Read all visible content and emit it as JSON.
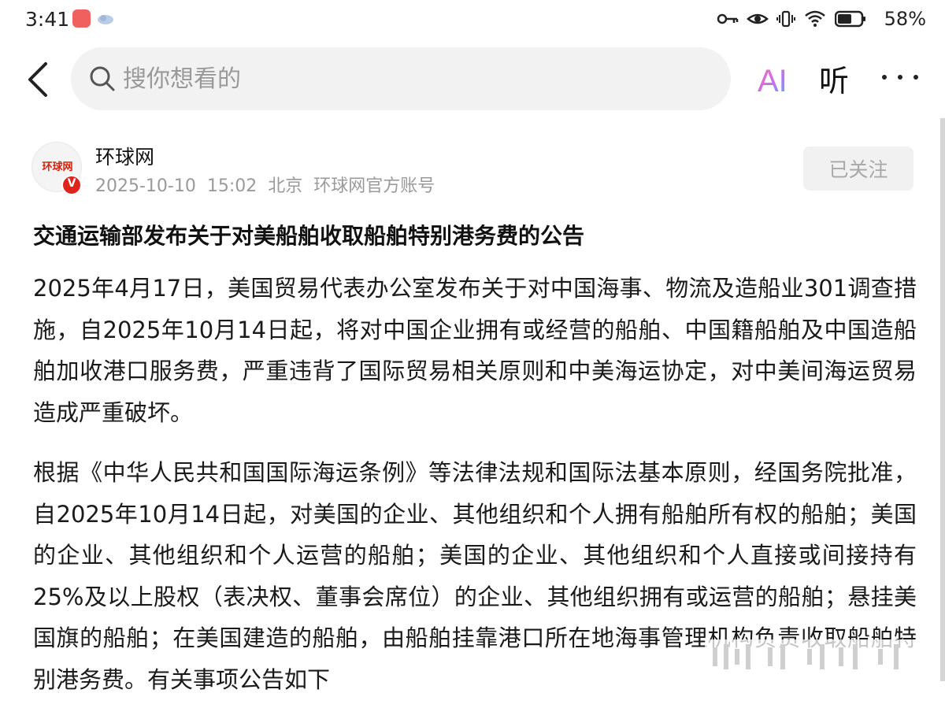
{
  "status_bar": {
    "time": "3:41",
    "battery_percent": "58%",
    "icons": [
      "key-icon",
      "eye-icon",
      "vibrate-icon",
      "wifi-icon",
      "battery-icon"
    ]
  },
  "top_bar": {
    "search_placeholder": "搜你想看的",
    "ai_label": "AI",
    "listen_label": "听"
  },
  "author": {
    "name": "环球网",
    "avatar_text": "环球网",
    "date": "2025-10-10",
    "time": "15:02",
    "location": "北京",
    "account_type": "环球网官方账号",
    "follow_label": "已关注",
    "verified_mark": "V"
  },
  "article": {
    "title": "交通运输部发布关于对美船舶收取船舶特别港务费的公告",
    "paragraphs": [
      "2025年4月17日，美国贸易代表办公室发布关于对中国海事、物流及造船业301调查措施，自2025年10月14日起，将对中国企业拥有或经营的船舶、中国籍船舶及中国造船舶加收港口服务费，严重违背了国际贸易相关原则和中美海运协定，对中美间海运贸易造成严重破坏。",
      "根据《中华人民共和国国际海运条例》等法律法规和国际法基本原则，经国务院批准，自2025年10月14日起，对美国的企业、其他组织和个人拥有船舶所有权的船舶；美国的企业、其他组织和个人运营的船舶；美国的企业、其他组织和个人直接或间接持有25%及以上股权（表决权、董事会席位）的企业、其他组织拥有或运营的船舶；悬挂美国旗的船舶；在美国建造的船舶，由船舶挂靠港口所在地海事管理机构负责收取船舶特别港务费。有关事项公告如下"
    ]
  },
  "colors": {
    "search_bg": "#f2f2f2",
    "follow_bg": "#f1f1f1",
    "verified_red": "#e0241b",
    "meta_gray": "#9a9a9a"
  }
}
